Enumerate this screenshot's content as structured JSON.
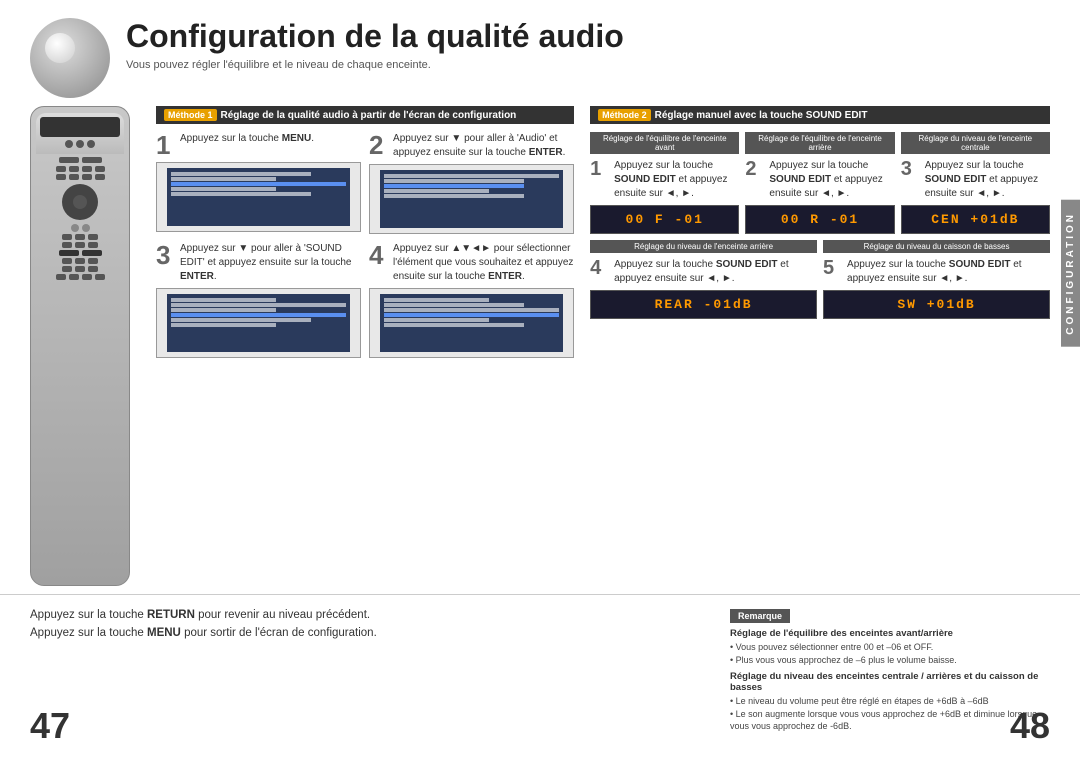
{
  "header": {
    "title": "Configuration de la qualité audio",
    "subtitle": "Vous pouvez régler l'équilibre et le niveau de chaque enceinte."
  },
  "method1": {
    "badge": "Méthode 1",
    "title": "Réglage de la qualité audio à partir de l'écran de configuration",
    "steps": [
      {
        "number": "1",
        "text": "Appuyez sur la touche ",
        "bold": "MENU",
        "after": "."
      },
      {
        "number": "2",
        "text_pre": "Appuyez sur ",
        "symbol": "▼",
        "text_after": " pour aller à 'Audio' et appuyez ensuite sur la touche ",
        "bold": "ENTER",
        "after": "."
      },
      {
        "number": "3",
        "text_pre": "Appuyez sur ",
        "symbol": "▼",
        "text_after": " pour aller à 'SOUND EDIT' et appuyez ensuite sur la touche ",
        "bold": "ENTER",
        "after": "."
      },
      {
        "number": "4",
        "text_pre": "Appuyez sur ",
        "symbol": "▲▼◄►",
        "text_after": " pour sélectionner l'élément que vous souhaitez et appuyez ensuite sur la touche ",
        "bold": "ENTER",
        "after": "."
      }
    ]
  },
  "method2": {
    "badge": "Méthode 2",
    "title": "Réglage manuel avec la touche SOUND EDIT",
    "sub_sections": [
      {
        "header": "Réglage de l'équilibre de l'enceinte avant",
        "step_number": "1",
        "text_pre": "Appuyez sur la touche ",
        "bold1": "SOUND",
        "text_mid": " EDIT et appuyez ensuite sur ",
        "symbol": "◄, ►",
        "display": "00 F -01"
      },
      {
        "header": "Réglage de l'équilibre de l'enceinte arrière",
        "step_number": "2",
        "text_pre": "Appuyez sur la touche ",
        "bold1": "SOUND",
        "text_mid": " EDIT et appuyez ensuite sur ",
        "symbol": "◄, ►",
        "display": "00 R -01"
      },
      {
        "header": "Réglage du niveau de l'enceinte centrale",
        "step_number": "3",
        "text_pre": "Appuyez sur la touche ",
        "bold1": "SOUND",
        "text_mid": " EDIT et appuyez ensuite sur ",
        "symbol": "◄, ►",
        "display": "CEN +01dB"
      },
      {
        "header": "Réglage du niveau de l'enceinte arrière",
        "step_number": "4",
        "text_pre": "Appuyez sur la touche ",
        "bold1": "SOUND",
        "text_mid": " EDIT et appuyez ensuite sur ",
        "symbol": "◄, ►",
        "display": "REAR -01dB"
      },
      {
        "header": "Réglage du niveau du caisson de basses",
        "step_number": "5",
        "text_pre": "Appuyez sur la touche ",
        "bold1": "SOUND",
        "text_mid": " EDIT et appuyez ensuite sur ",
        "symbol": "◄, ►",
        "display": "SW  +01dB"
      }
    ]
  },
  "bottom": {
    "line1_pre": "Appuyez sur la touche ",
    "line1_bold": "RETURN",
    "line1_after": " pour revenir au niveau précédent.",
    "line2_pre": "Appuyez sur la touche ",
    "line2_bold": "MENU",
    "line2_after": " pour sortir de l'écran de configuration."
  },
  "remark": {
    "label": "Remarque",
    "section1_title": "Réglage de l'équilibre des enceintes avant/arrière",
    "section1_bullets": [
      "Vous pouvez sélectionner entre 00 et –06 et OFF.",
      "Plus vous vous approchez de –6 plus le volume baisse."
    ],
    "section2_title": "Réglage du niveau des enceintes centrale / arrières et du caisson de basses",
    "section2_bullets": [
      "Le niveau du volume peut être réglé en étapes de +6dB à –6dB",
      "Le son augmente lorsque vous vous approchez de +6dB et diminue lorsque vous vous approchez de -6dB."
    ]
  },
  "pages": {
    "left": "47",
    "right": "48"
  },
  "sidebar": {
    "label": "CONFIGURATION"
  }
}
